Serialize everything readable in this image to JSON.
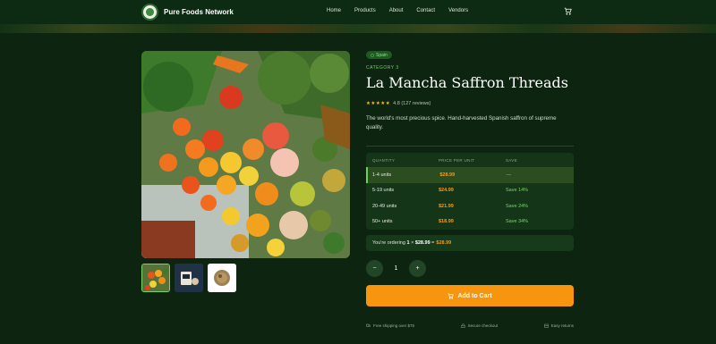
{
  "header": {
    "brand_name": "Pure Foods Network",
    "nav": [
      "Home",
      "Products",
      "About",
      "Contact",
      "Vendors"
    ],
    "cart_icon": "cart-icon"
  },
  "gallery": {
    "main_image": "fresh vegetables and fruits photo",
    "thumbnails": [
      "vegetables thumbnail",
      "saffron packaging thumbnail",
      "saffron threads thumbnail"
    ]
  },
  "product": {
    "origin": "Spain",
    "category": "CATEGORY 3",
    "title": "La Mancha Saffron Threads",
    "stars": "★★★★★",
    "rating": 4.8,
    "rating_text": "4.8 (127 reviews)",
    "description": "The world's most precious spice. Hand-harvested Spanish saffron of supreme quality."
  },
  "pricing": {
    "headers": [
      "QUANTITY",
      "PRICE PER UNIT",
      "SAVE"
    ],
    "rows": [
      {
        "qty": "1-4 units",
        "price": "$28.99",
        "save": "—"
      },
      {
        "qty": "5-19 units",
        "price": "$24.99",
        "save": "Save 14%"
      },
      {
        "qty": "20-49 units",
        "price": "$21.99",
        "save": "Save 24%"
      },
      {
        "qty": "50+ units",
        "price": "$18.99",
        "save": "Save 34%"
      }
    ]
  },
  "order": {
    "prefix": "You're ordering",
    "quantity": "1",
    "times": "×",
    "unit_price": "$28.99",
    "equals": "=",
    "total": "$28.99"
  },
  "quantity_selector": {
    "minus": "−",
    "value": "1",
    "plus": "+"
  },
  "actions": {
    "add_to_cart": "Add to Cart"
  },
  "perks": [
    "Free shipping over $75",
    "Secure checkout",
    "Easy returns"
  ],
  "colors": {
    "accent": "#f7950f",
    "background": "#0c2410",
    "green": "#7fd46e"
  }
}
